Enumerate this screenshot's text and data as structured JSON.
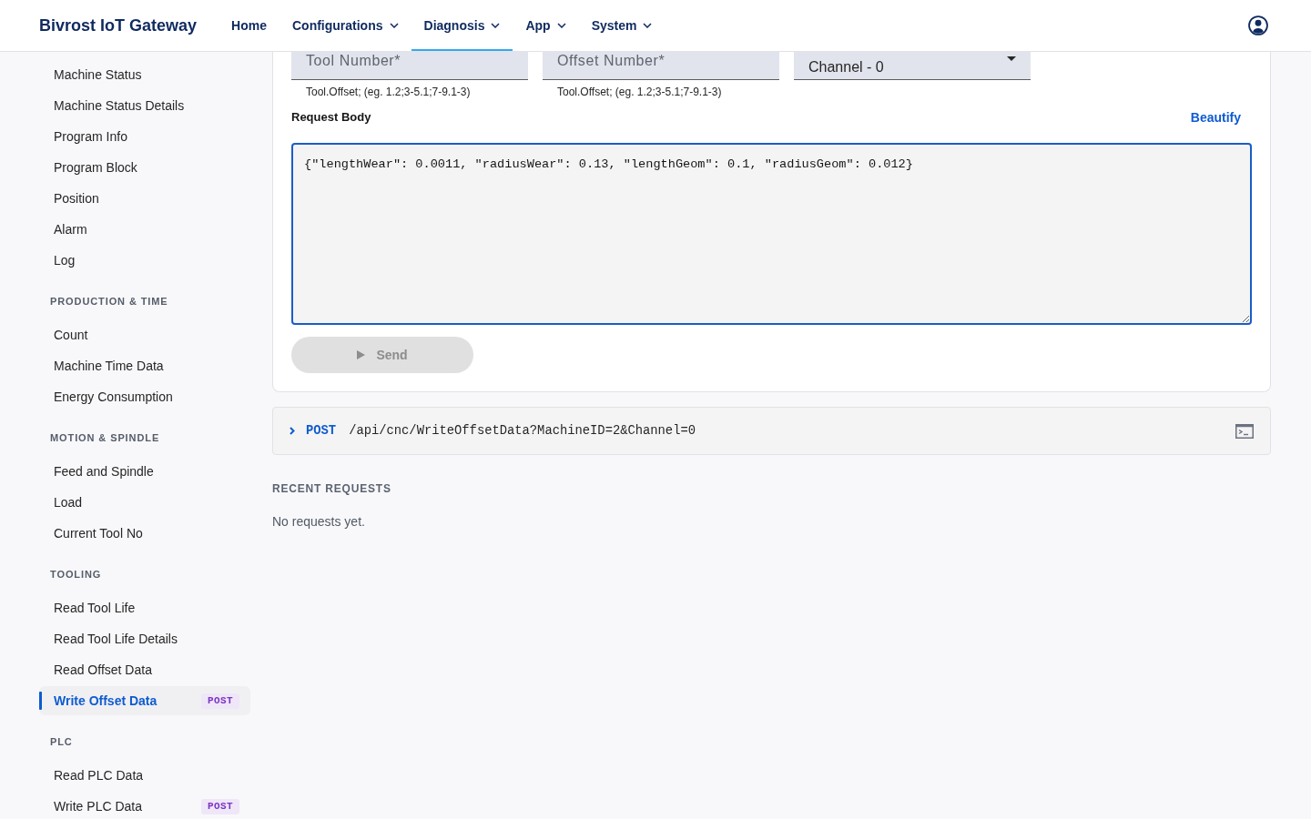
{
  "header": {
    "brand": "Bivrost IoT Gateway",
    "nav": [
      {
        "label": "Home",
        "selected": false,
        "dropdown": false
      },
      {
        "label": "Configurations",
        "selected": false,
        "dropdown": true
      },
      {
        "label": "Diagnosis",
        "selected": true,
        "dropdown": true
      },
      {
        "label": "App",
        "selected": false,
        "dropdown": true
      },
      {
        "label": "System",
        "selected": false,
        "dropdown": true
      }
    ]
  },
  "sidebar": {
    "sections": [
      {
        "items": [
          {
            "label": "Machine Status",
            "selected": false
          },
          {
            "label": "Machine Status Details",
            "selected": false
          },
          {
            "label": "Program Info",
            "selected": false
          },
          {
            "label": "Program Block",
            "selected": false
          },
          {
            "label": "Position",
            "selected": false
          },
          {
            "label": "Alarm",
            "selected": false
          },
          {
            "label": "Log",
            "selected": false
          }
        ]
      },
      {
        "heading": "PRODUCTION & TIME",
        "items": [
          {
            "label": "Count",
            "selected": false
          },
          {
            "label": "Machine Time Data",
            "selected": false
          },
          {
            "label": "Energy Consumption",
            "selected": false
          }
        ]
      },
      {
        "heading": "MOTION & SPINDLE",
        "items": [
          {
            "label": "Feed and Spindle",
            "selected": false
          },
          {
            "label": "Load",
            "selected": false
          },
          {
            "label": "Current Tool No",
            "selected": false
          }
        ]
      },
      {
        "heading": "TOOLING",
        "items": [
          {
            "label": "Read Tool Life",
            "selected": false
          },
          {
            "label": "Read Tool Life Details",
            "selected": false
          },
          {
            "label": "Read Offset Data",
            "selected": false
          },
          {
            "label": "Write Offset Data",
            "selected": true,
            "badge": "POST"
          }
        ]
      },
      {
        "heading": "PLC",
        "items": [
          {
            "label": "Read PLC Data",
            "selected": false
          },
          {
            "label": "Write PLC Data",
            "selected": false,
            "badge": "POST"
          }
        ]
      }
    ]
  },
  "form": {
    "fields": [
      {
        "kind": "input",
        "placeholder": "Tool Number*",
        "helper": "Tool.Offset; (eg. 1.2;3-5.1;7-9.1-3)"
      },
      {
        "kind": "input",
        "placeholder": "Offset Number*",
        "helper": "Tool.Offset; (eg. 1.2;3-5.1;7-9.1-3)"
      },
      {
        "kind": "select",
        "value": "Channel - 0"
      }
    ],
    "request_body": {
      "label": "Request Body",
      "action": "Beautify",
      "value": "{\"lengthWear\": 0.0011, \"radiusWear\": 0.13, \"lengthGeom\": 0.1, \"radiusGeom\": 0.012}"
    },
    "send_button": {
      "label": "Send",
      "disabled": true
    }
  },
  "request_bar": {
    "expanded": false,
    "method": "POST",
    "path": "/api/cnc/WriteOffsetData?MachineID=2&Channel=0"
  },
  "recent_requests": {
    "heading": "RECENT REQUESTS",
    "empty_text": "No requests yet."
  }
}
